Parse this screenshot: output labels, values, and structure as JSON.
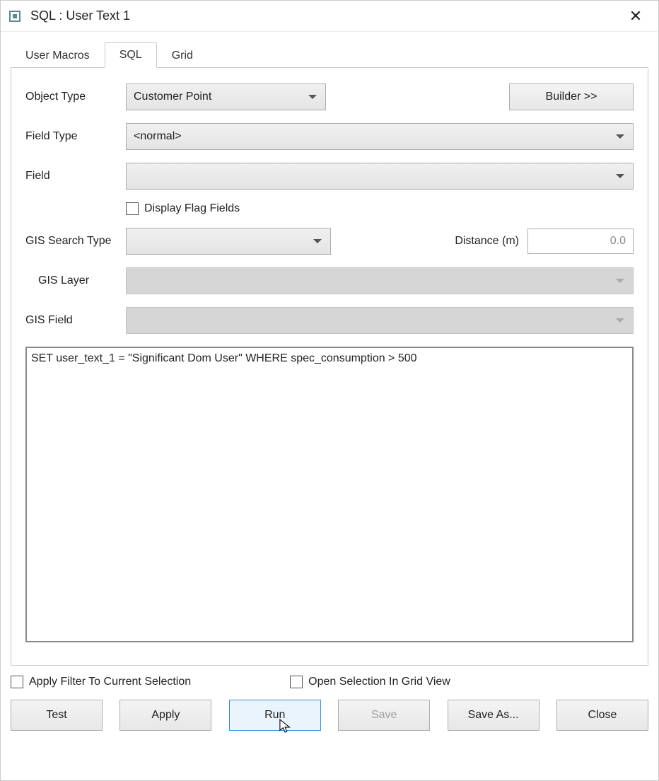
{
  "window": {
    "title": "SQL : User Text 1"
  },
  "tabs": {
    "user_macros": "User Macros",
    "sql": "SQL",
    "grid": "Grid"
  },
  "form": {
    "object_type_label": "Object Type",
    "object_type_value": "Customer Point",
    "builder_label": "Builder >>",
    "field_type_label": "Field Type",
    "field_type_value": "<normal>",
    "field_label": "Field",
    "field_value": "",
    "display_flag_label": "Display Flag Fields",
    "gis_search_label": "GIS Search Type",
    "gis_search_value": "",
    "distance_label": "Distance (m)",
    "distance_value": "0.0",
    "gis_layer_label": "GIS Layer",
    "gis_layer_value": "",
    "gis_field_label": "GIS Field",
    "gis_field_value": "",
    "sql_text": "SET user_text_1 = \"Significant Dom User\" WHERE spec_consumption > 500"
  },
  "bottom": {
    "apply_filter_label": "Apply Filter To Current Selection",
    "open_grid_label": "Open Selection In Grid View",
    "test": "Test",
    "apply": "Apply",
    "run": "Run",
    "save": "Save",
    "save_as": "Save As...",
    "close": "Close"
  }
}
